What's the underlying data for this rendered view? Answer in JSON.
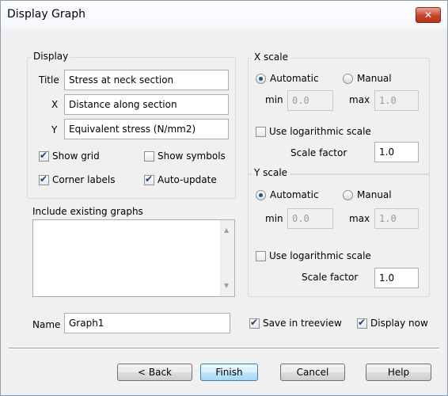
{
  "window": {
    "title": "Display Graph",
    "close_label": "✕"
  },
  "display": {
    "legend": "Display",
    "title_label": "Title",
    "title_value": "Stress at neck section",
    "x_label": "X",
    "x_value": "Distance along section",
    "y_label": "Y",
    "y_value": "Equivalent stress (N/mm2)",
    "show_grid": {
      "label": "Show grid",
      "checked": true
    },
    "show_symbols": {
      "label": "Show symbols",
      "checked": false
    },
    "corner_labels": {
      "label": "Corner labels",
      "checked": true
    },
    "auto_update": {
      "label": "Auto-update",
      "checked": true
    }
  },
  "existing": {
    "label": "Include existing graphs",
    "items": []
  },
  "xscale": {
    "legend": "X scale",
    "automatic": "Automatic",
    "manual": "Manual",
    "mode": "Automatic",
    "min_label": "min",
    "min_value": "0.0",
    "max_label": "max",
    "max_value": "1.0",
    "log": {
      "label": "Use logarithmic scale",
      "checked": false
    },
    "factor_label": "Scale factor",
    "factor_value": "1.0"
  },
  "yscale": {
    "legend": "Y scale",
    "automatic": "Automatic",
    "manual": "Manual",
    "mode": "Automatic",
    "min_label": "min",
    "min_value": "0.0",
    "max_label": "max",
    "max_value": "1.0",
    "log": {
      "label": "Use logarithmic scale",
      "checked": false
    },
    "factor_label": "Scale factor",
    "factor_value": "1.0"
  },
  "name": {
    "label": "Name",
    "value": "Graph1"
  },
  "save_treeview": {
    "label": "Save in treeview",
    "checked": true
  },
  "display_now": {
    "label": "Display now",
    "checked": true
  },
  "buttons": {
    "back": "< Back",
    "finish": "Finish",
    "cancel": "Cancel",
    "help": "Help"
  }
}
